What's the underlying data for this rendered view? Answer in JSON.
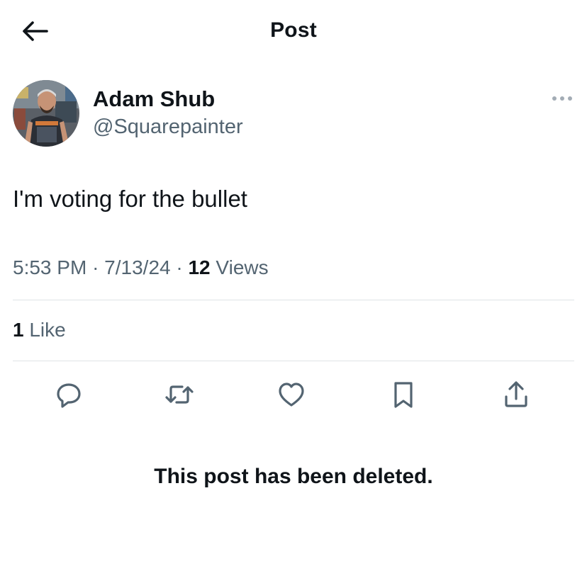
{
  "header": {
    "title": "Post",
    "back_icon": "arrow-left-icon"
  },
  "author": {
    "display_name": "Adam Shub",
    "handle": "@Squarepainter",
    "avatar_icon": "avatar-photo"
  },
  "post": {
    "text": "I'm voting for the bullet",
    "time": "5:53 PM",
    "separator": "·",
    "date": "7/13/24",
    "views_count": "12",
    "views_label": "Views",
    "likes_count": "1",
    "likes_label": "Like"
  },
  "actions": [
    {
      "name": "reply",
      "icon": "reply-icon"
    },
    {
      "name": "repost",
      "icon": "repost-icon"
    },
    {
      "name": "like",
      "icon": "heart-icon"
    },
    {
      "name": "bookmark",
      "icon": "bookmark-icon"
    },
    {
      "name": "share",
      "icon": "share-icon"
    }
  ],
  "status_message": "This post has been deleted.",
  "colors": {
    "text_primary": "#0f1419",
    "text_secondary": "#536471",
    "divider": "#dfe3e6",
    "icon": "#536471"
  }
}
